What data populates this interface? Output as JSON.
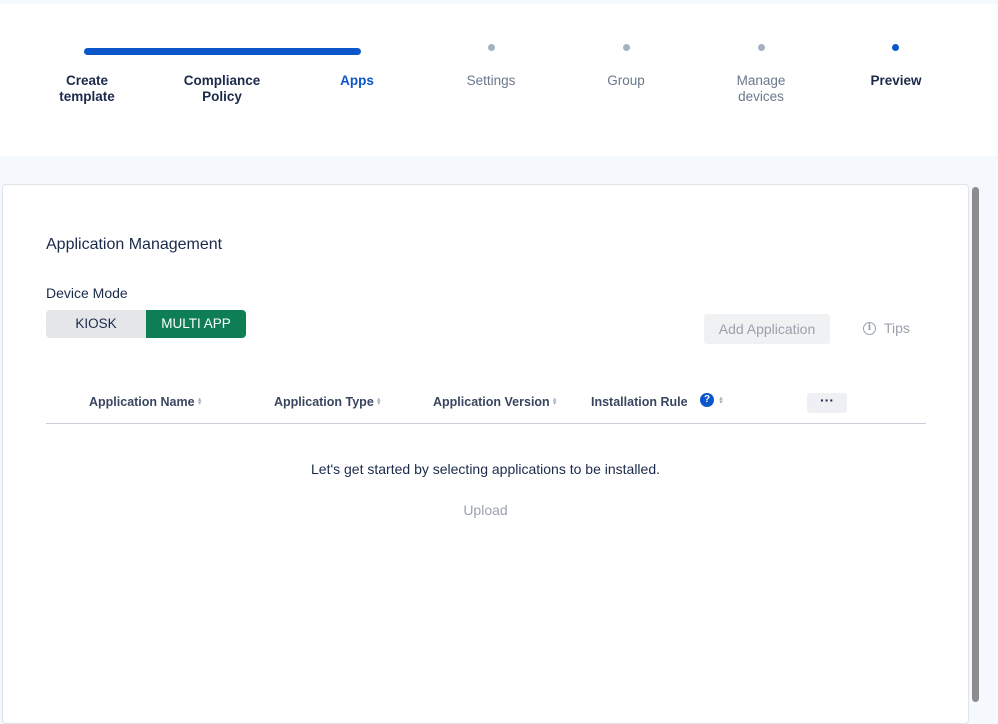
{
  "stepper": {
    "steps": [
      {
        "label": "Create\ntemplate",
        "state": "done"
      },
      {
        "label": "Compliance\nPolicy",
        "state": "done"
      },
      {
        "label": "Apps",
        "state": "current"
      },
      {
        "label": "Settings",
        "state": "pending"
      },
      {
        "label": "Group",
        "state": "pending"
      },
      {
        "label": "Manage\ndevices",
        "state": "pending"
      },
      {
        "label": "Preview",
        "state": "next"
      }
    ],
    "progress": 0.33
  },
  "card": {
    "title": "Application Management",
    "device_mode_label": "Device Mode",
    "mode_options": [
      "KIOSK",
      "MULTI APP"
    ],
    "mode_selected": "MULTI APP",
    "add_application_label": "Add Application",
    "tips_label": "Tips",
    "tips_icon": "info-icon"
  },
  "table": {
    "columns": [
      "Application Name",
      "Application Type",
      "Application Version",
      "Installation Rule"
    ],
    "help_icon": "question-icon",
    "more_label": "···",
    "empty_message": "Let's get started by selecting applications to be installed.",
    "upload_label": "Upload"
  },
  "colors": {
    "accent": "#0b57c9",
    "toggle_on": "#0e7f55",
    "muted": "#9aa1ad"
  }
}
